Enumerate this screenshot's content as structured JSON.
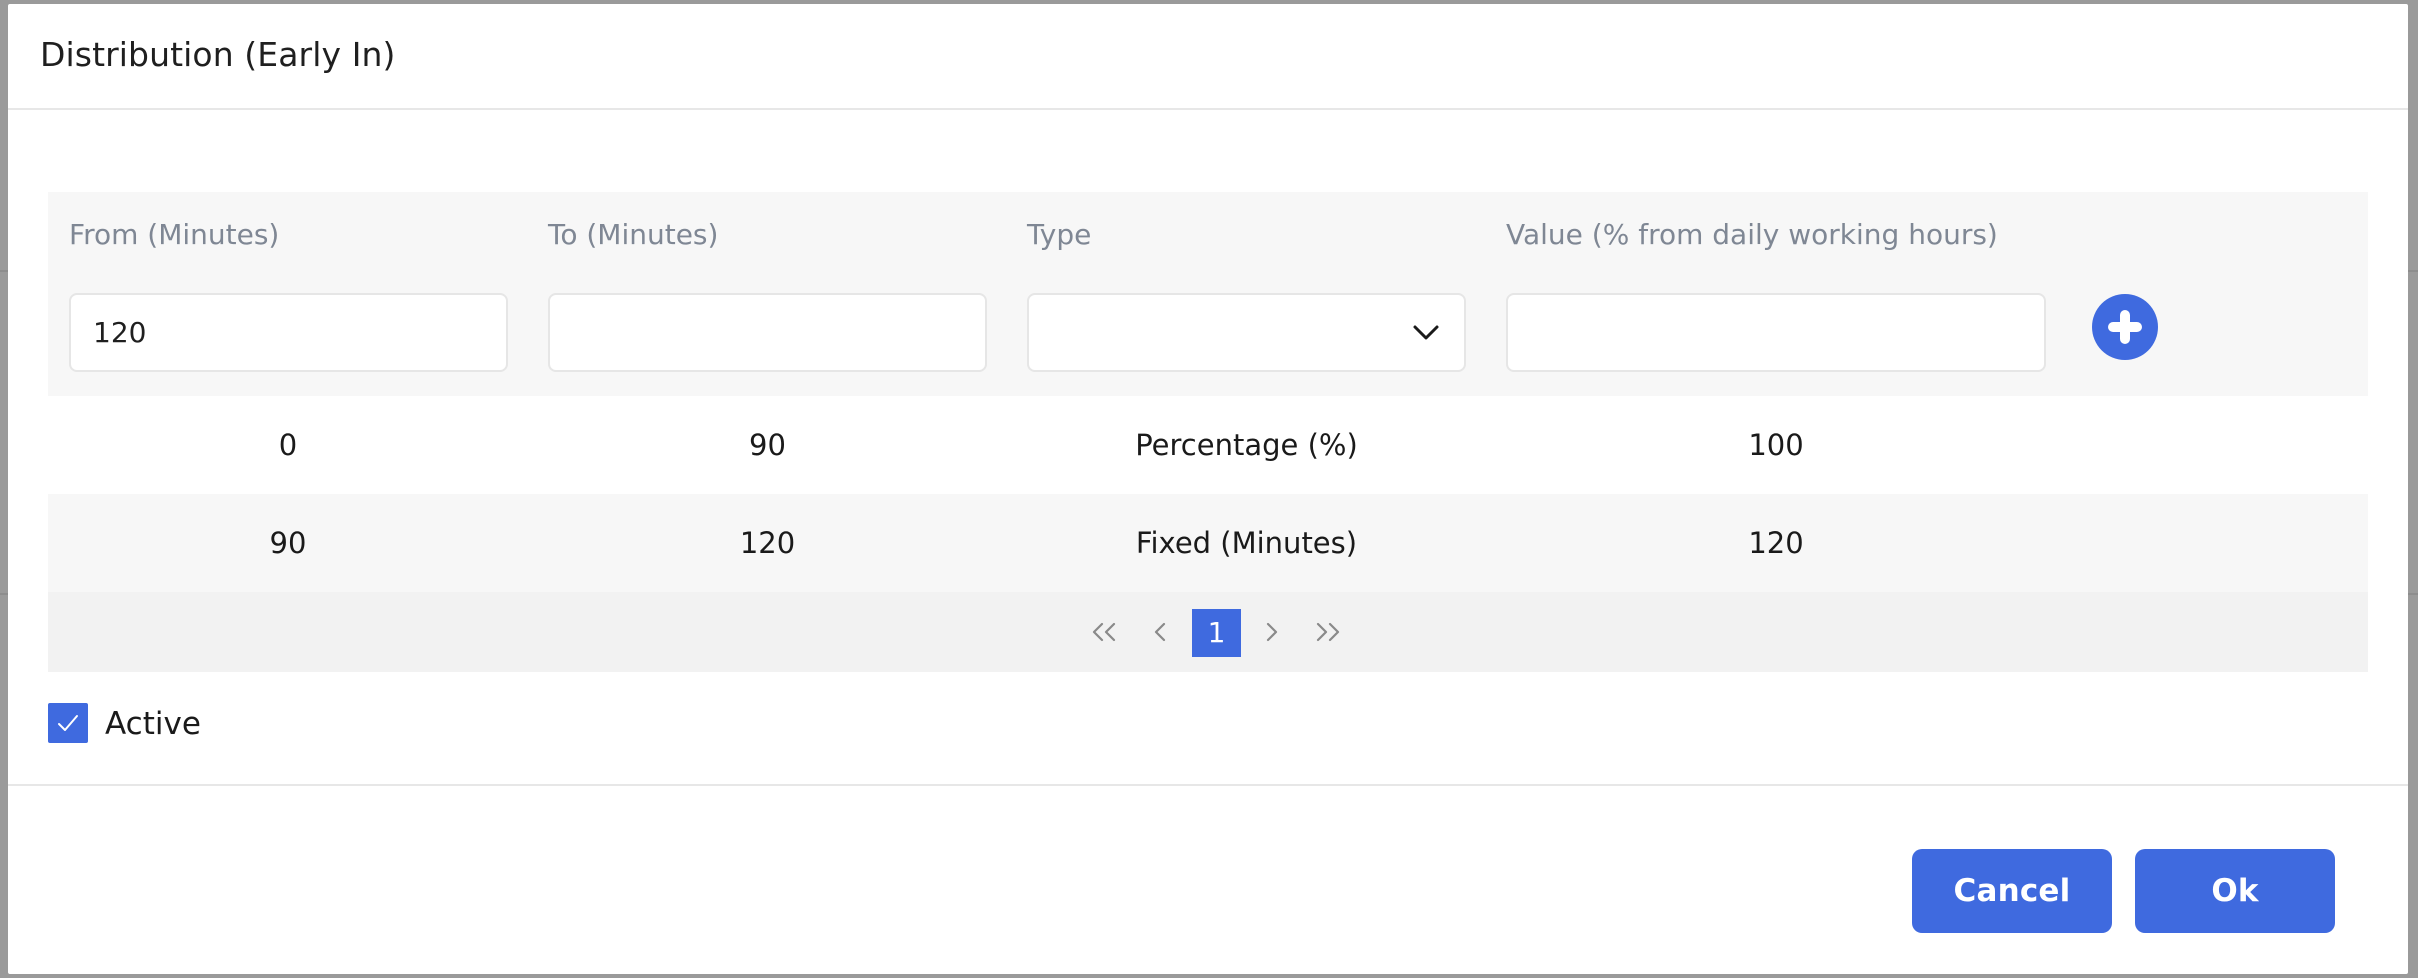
{
  "dialog": {
    "title": "Distribution (Early In)"
  },
  "columns": [
    {
      "label": "From (Minutes)"
    },
    {
      "label": "To (Minutes)"
    },
    {
      "label": "Type"
    },
    {
      "label": "Value (% from daily working hours)"
    }
  ],
  "inputs": {
    "from": {
      "value": "120",
      "placeholder": ""
    },
    "to": {
      "value": "",
      "placeholder": ""
    },
    "type": {
      "selected": ""
    },
    "value": {
      "value": "",
      "placeholder": ""
    }
  },
  "rows": [
    {
      "from": "0",
      "to": "90",
      "type": "Percentage (%)",
      "value": "100"
    },
    {
      "from": "90",
      "to": "120",
      "type": "Fixed (Minutes)",
      "value": "120"
    }
  ],
  "pagination": {
    "first": "«",
    "prev": "‹",
    "current": "1",
    "next": "›",
    "last": "»"
  },
  "active": {
    "label": "Active",
    "checked": true
  },
  "buttons": {
    "cancel": "Cancel",
    "ok": "Ok"
  },
  "colors": {
    "accent": "#3f6adf",
    "label_gray": "#7f8794",
    "row_alt": "#f7f7f7"
  },
  "icons": {
    "add": "plus-circle-icon",
    "type_select": "chevron-down-icon",
    "active": "check-icon"
  }
}
